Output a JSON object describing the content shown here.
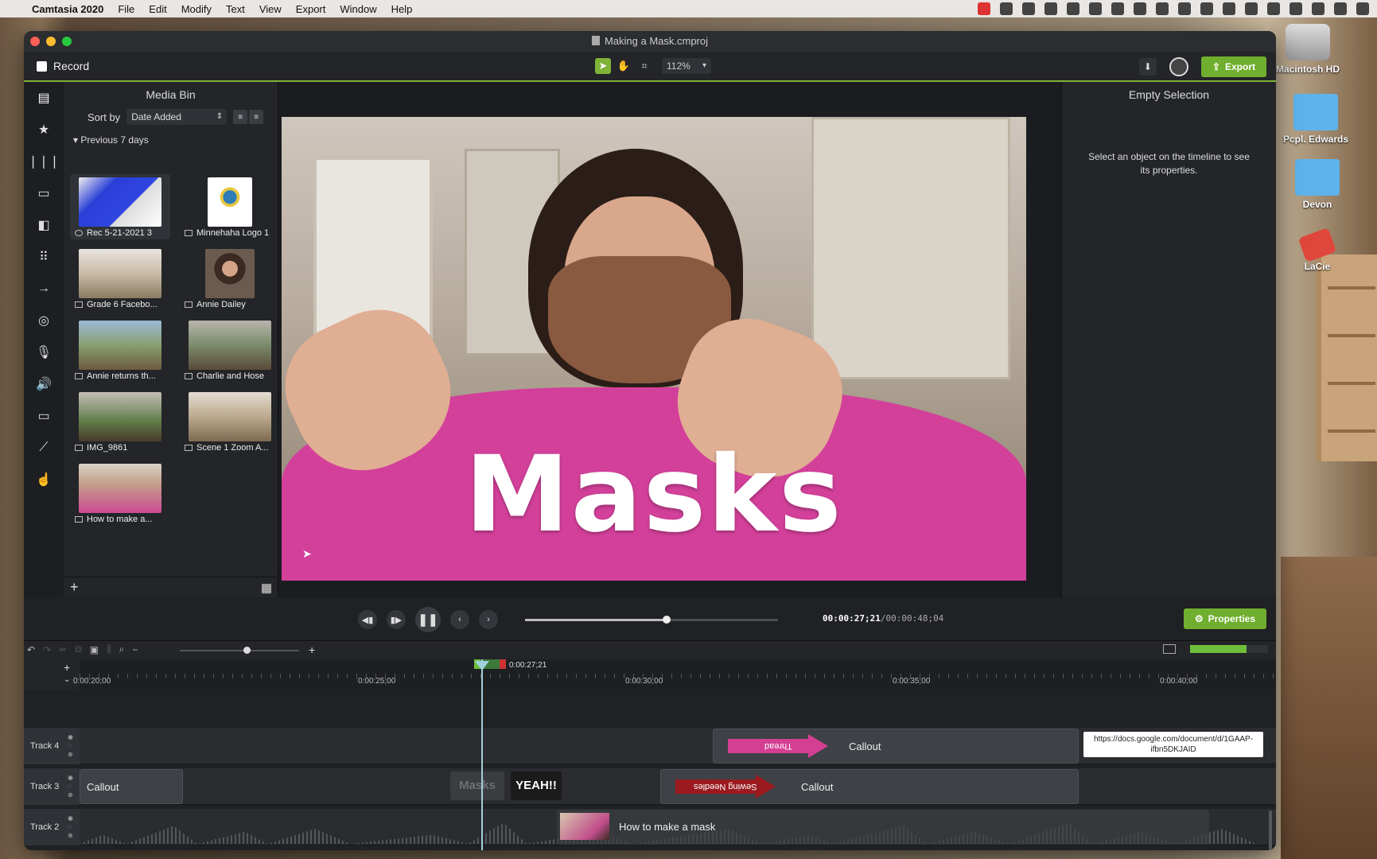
{
  "menubar": {
    "app_name": "Camtasia 2020",
    "items": [
      "File",
      "Edit",
      "Modify",
      "Text",
      "View",
      "Export",
      "Window",
      "Help"
    ]
  },
  "window": {
    "title": "Making a Mask.cmproj"
  },
  "toolbar": {
    "record_label": "Record",
    "zoom_value": "112%",
    "export_label": "Export"
  },
  "media_bin": {
    "title": "Media Bin",
    "sort_label": "Sort by",
    "sort_value": "Date Added",
    "group_label": "Previous 7 days",
    "clips": [
      {
        "label": "Rec 5-21-2021 3",
        "kind": "recording"
      },
      {
        "label": "Minnehaha Logo 1",
        "kind": "image"
      },
      {
        "label": "Grade 6 Facebo...",
        "kind": "image"
      },
      {
        "label": "Annie Dailey",
        "kind": "image"
      },
      {
        "label": "Annie returns th...",
        "kind": "video"
      },
      {
        "label": "Charlie and Hose",
        "kind": "video"
      },
      {
        "label": "IMG_9861",
        "kind": "video"
      },
      {
        "label": "Scene 1 Zoom A...",
        "kind": "video"
      },
      {
        "label": "How to make a...",
        "kind": "video"
      }
    ]
  },
  "canvas": {
    "overlay_title": "Masks"
  },
  "properties": {
    "title": "Empty Selection",
    "message": "Select an object on the timeline to see its properties."
  },
  "playback": {
    "progress": 0.56,
    "time_current": "00:00:27;21",
    "time_total": "/00:00:48;04",
    "properties_label": "Properties"
  },
  "timeline": {
    "zoom_level": 0.56,
    "audio_level": 0.72,
    "playhead_label": "0:00:27;21",
    "ruler_labels": [
      "0:00:20;00",
      "0:00:25;00",
      "0:00:30;00",
      "0:00:35;00",
      "0:00:40;00"
    ],
    "tracks": [
      {
        "name": "Track 4"
      },
      {
        "name": "Track 3"
      },
      {
        "name": "Track 2"
      }
    ],
    "track4": {
      "arrow_text": "Thread",
      "callout": "Callout",
      "url": "https://docs.google.com/document/d/1GAAP-ifbn5DKJAID"
    },
    "track3": {
      "callout1": "Callout",
      "masks": "Masks",
      "yeah": "YEAH!!",
      "arrow_text": "Sewing Needles",
      "callout2": "Callout"
    },
    "track2": {
      "clip_label": "How to make a mask"
    }
  },
  "desktop": {
    "icons": [
      "Macintosh HD",
      "Pcpl. Edwards",
      "Devon",
      "LaCie"
    ]
  }
}
